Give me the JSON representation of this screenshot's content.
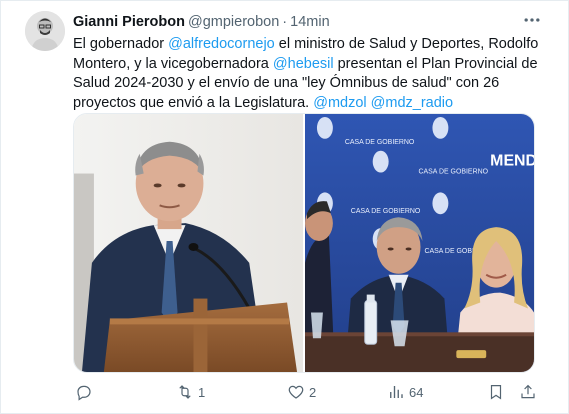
{
  "author": {
    "display_name": "Gianni Pierobon",
    "handle": "@gmpierobon",
    "separator": "·",
    "time": "14min"
  },
  "text": {
    "p1": "El gobernador ",
    "m1": "@alfredocornejo",
    "p2": " el ministro de Salud y Deportes, Rodolfo Montero, y la vicegobernadora ",
    "m2": "@hebesil",
    "p3": " presentan el Plan Provincial de Salud 2024-2030 y el envío de una \"ley Ómnibus de salud\" con 26 proyectos que envió a la Legislatura. ",
    "m3": "@mdzol",
    "p4": " ",
    "m4": "@mdz_radio"
  },
  "media": {
    "left_photo_icon": "photo-podium",
    "right_photo_icon": "photo-table",
    "banner_words": {
      "casa": "CASA DE GOBIERNO",
      "brand": "MENDO"
    }
  },
  "actions": {
    "reply_count": "",
    "retweet_count": "1",
    "like_count": "2",
    "views_count": "64"
  },
  "icons": {
    "more": "more-icon",
    "reply": "reply-icon",
    "retweet": "retweet-icon",
    "like": "heart-icon",
    "views": "views-icon",
    "bookmark": "bookmark-icon",
    "share": "share-icon"
  },
  "colors": {
    "accent": "#1d9bf0",
    "secondary_text": "#536471",
    "banner_blue": "#2a4fa8"
  }
}
